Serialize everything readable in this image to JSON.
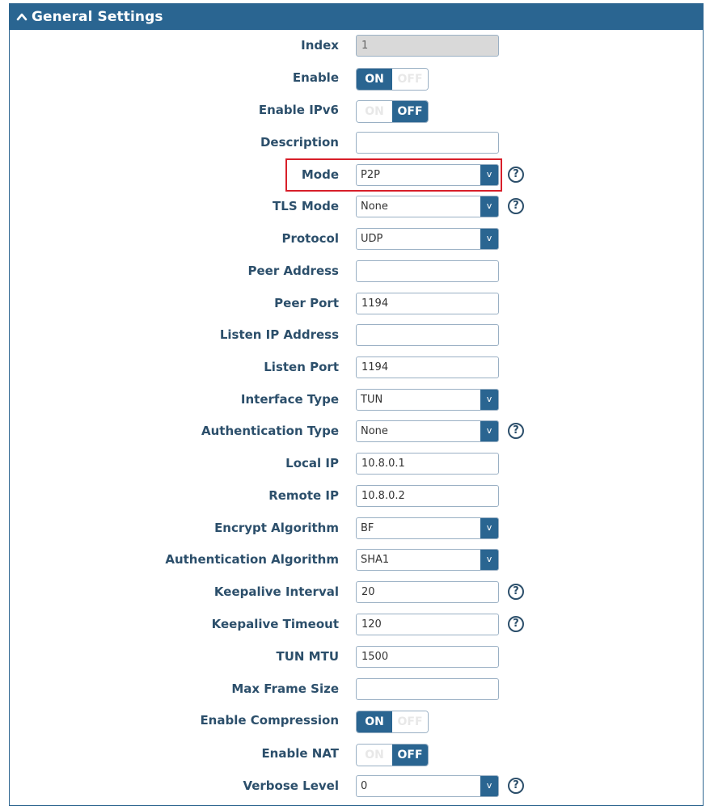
{
  "panel": {
    "title": "General Settings",
    "toggle_icon": "chevron-up-icon"
  },
  "fields": {
    "index": {
      "label": "Index",
      "value": "1"
    },
    "enable": {
      "label": "Enable",
      "on": "ON",
      "off": "OFF",
      "state": "ON"
    },
    "enable_ipv6": {
      "label": "Enable IPv6",
      "on": "ON",
      "off": "OFF",
      "state": "OFF"
    },
    "description": {
      "label": "Description",
      "value": ""
    },
    "mode": {
      "label": "Mode",
      "value": "P2P"
    },
    "tls_mode": {
      "label": "TLS Mode",
      "value": "None"
    },
    "protocol": {
      "label": "Protocol",
      "value": "UDP"
    },
    "peer_address": {
      "label": "Peer Address",
      "value": ""
    },
    "peer_port": {
      "label": "Peer Port",
      "value": "1194"
    },
    "listen_ip": {
      "label": "Listen IP Address",
      "value": ""
    },
    "listen_port": {
      "label": "Listen Port",
      "value": "1194"
    },
    "interface_type": {
      "label": "Interface Type",
      "value": "TUN"
    },
    "auth_type": {
      "label": "Authentication Type",
      "value": "None"
    },
    "local_ip": {
      "label": "Local IP",
      "value": "10.8.0.1"
    },
    "remote_ip": {
      "label": "Remote IP",
      "value": "10.8.0.2"
    },
    "encrypt_algorithm": {
      "label": "Encrypt Algorithm",
      "value": "BF"
    },
    "auth_algorithm": {
      "label": "Authentication Algorithm",
      "value": "SHA1"
    },
    "keepalive_interval": {
      "label": "Keepalive Interval",
      "value": "20"
    },
    "keepalive_timeout": {
      "label": "Keepalive Timeout",
      "value": "120"
    },
    "tun_mtu": {
      "label": "TUN MTU",
      "value": "1500"
    },
    "max_frame_size": {
      "label": "Max Frame Size",
      "value": ""
    },
    "enable_compression": {
      "label": "Enable Compression",
      "on": "ON",
      "off": "OFF",
      "state": "ON"
    },
    "enable_nat": {
      "label": "Enable NAT",
      "on": "ON",
      "off": "OFF",
      "state": "OFF"
    },
    "verbose_level": {
      "label": "Verbose Level",
      "value": "0"
    }
  },
  "help_glyph": "?",
  "dropdown_glyph": "v",
  "colors": {
    "accent": "#2a6591",
    "label": "#2c4f6b",
    "highlight": "#d81f2a"
  }
}
